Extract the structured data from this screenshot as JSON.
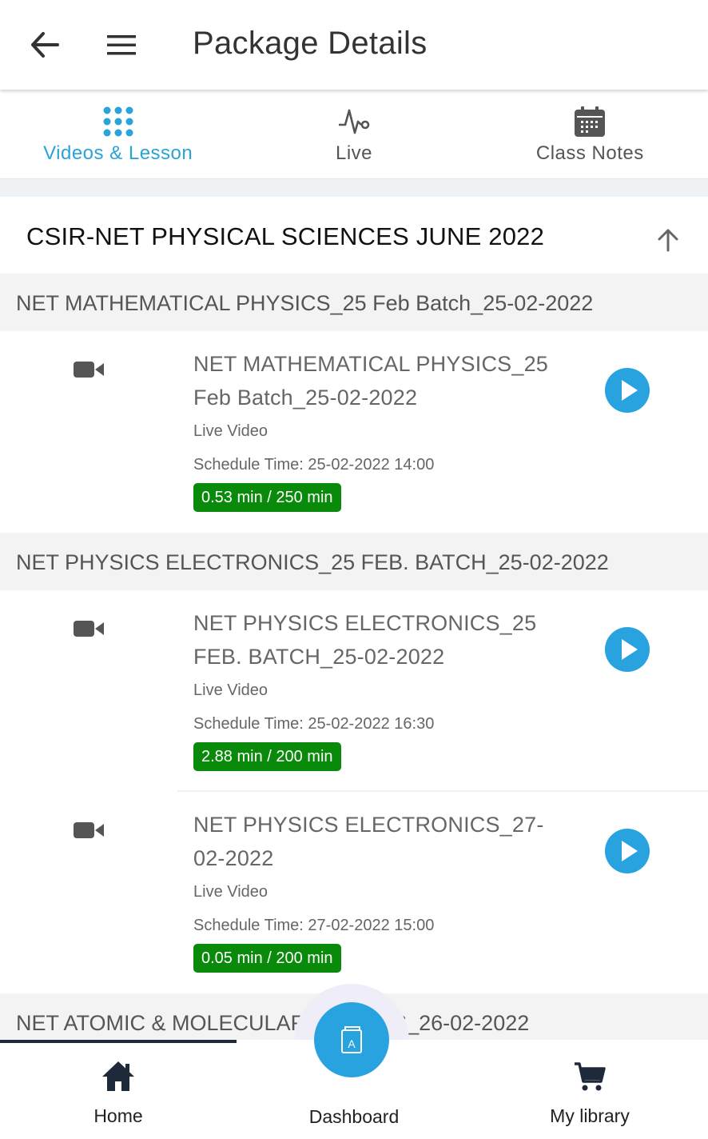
{
  "appbar": {
    "title": "Package Details"
  },
  "tabs": [
    {
      "label": "Videos & Lesson",
      "icon": "grid-icon",
      "active": true
    },
    {
      "label": "Live",
      "icon": "pulse-icon",
      "active": false
    },
    {
      "label": "Class Notes",
      "icon": "calendar-icon",
      "active": false
    }
  ],
  "package": {
    "title": "CSIR-NET PHYSICAL SCIENCES JUNE 2022"
  },
  "sections": [
    {
      "title": "NET MATHEMATICAL PHYSICS_25 Feb Batch_25-02-2022",
      "items": [
        {
          "title": "NET MATHEMATICAL PHYSICS_25 Feb Batch_25-02-2022",
          "type": "Live Video",
          "schedule": "Schedule Time: 25-02-2022 14:00",
          "progress": "0.53 min / 250 min"
        }
      ]
    },
    {
      "title": "NET PHYSICS ELECTRONICS_25 FEB. BATCH_25-02-2022",
      "items": [
        {
          "title": "NET PHYSICS ELECTRONICS_25 FEB. BATCH_25-02-2022",
          "type": "Live Video",
          "schedule": "Schedule Time: 25-02-2022 16:30",
          "progress": "2.88 min / 200 min"
        },
        {
          "title": "NET PHYSICS ELECTRONICS_27-02-2022",
          "type": "Live Video",
          "schedule": "Schedule Time: 27-02-2022 15:00",
          "progress": "0.05 min / 200 min"
        }
      ]
    },
    {
      "title": "NET ATOMIC & MOLECULAR PHYSICS_26-02-2022",
      "items": []
    }
  ],
  "bottom_nav": {
    "home": "Home",
    "dashboard": "Dashboard",
    "library": "My library"
  },
  "colors": {
    "accent": "#29a3d8",
    "badge": "#0a8a0a",
    "play": "#29a3e0"
  }
}
